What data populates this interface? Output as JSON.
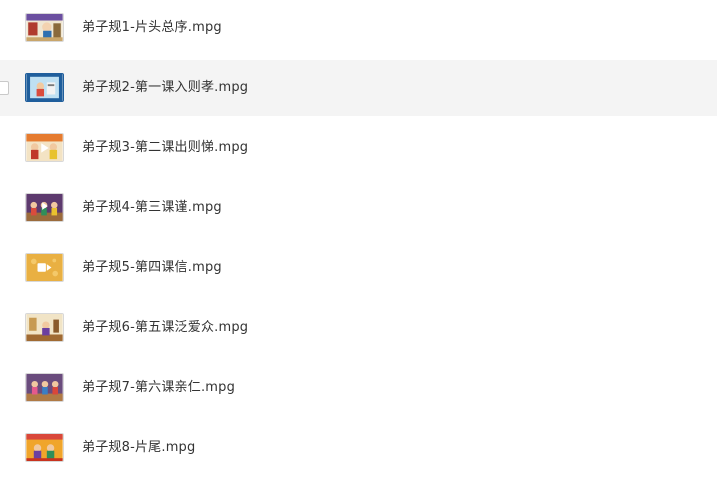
{
  "colors": {
    "row_hover_bg": "#f4f4f4",
    "text": "#333333",
    "background": "#ffffff"
  },
  "files": [
    {
      "name": "弟子规1-片头总序.mpg",
      "icon": "video-thumbnail"
    },
    {
      "name": "弟子规2-第一课入则孝.mpg",
      "icon": "video-thumbnail"
    },
    {
      "name": "弟子规3-第二课出则悌.mpg",
      "icon": "video-thumbnail"
    },
    {
      "name": "弟子规4-第三课谨.mpg",
      "icon": "video-thumbnail"
    },
    {
      "name": "弟子规5-第四课信.mpg",
      "icon": "video-thumbnail"
    },
    {
      "name": "弟子规6-第五课泛爱众.mpg",
      "icon": "video-thumbnail"
    },
    {
      "name": "弟子规7-第六课亲仁.mpg",
      "icon": "video-thumbnail"
    },
    {
      "name": "弟子规8-片尾.mpg",
      "icon": "video-thumbnail"
    }
  ]
}
